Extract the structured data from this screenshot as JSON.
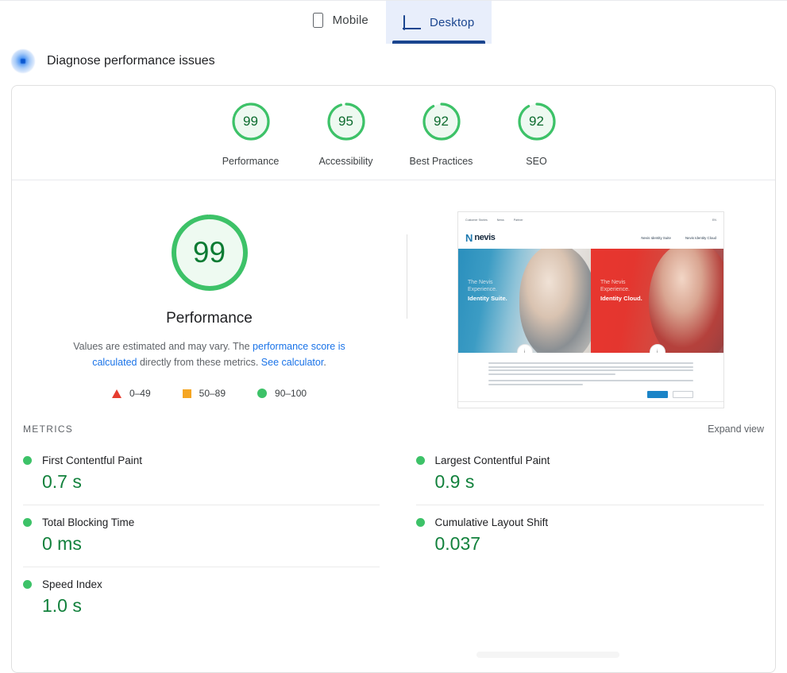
{
  "tabs": [
    {
      "label": "Mobile",
      "icon": "phone-icon",
      "active": false
    },
    {
      "label": "Desktop",
      "icon": "monitor-icon",
      "active": true
    }
  ],
  "diagnose": {
    "title": "Diagnose performance issues",
    "icon": "sparkle-icon"
  },
  "category_scores": [
    {
      "label": "Performance",
      "score": "99"
    },
    {
      "label": "Accessibility",
      "score": "95"
    },
    {
      "label": "Best Practices",
      "score": "92"
    },
    {
      "label": "SEO",
      "score": "92"
    }
  ],
  "hero": {
    "score": "99",
    "category": "Performance",
    "note_part1": "Values are estimated and may vary. The ",
    "note_link1": "performance score is calculated",
    "note_part2": " directly from these metrics. ",
    "note_link2": "See calculator",
    "note_part3": "."
  },
  "legend": [
    {
      "shape": "triangle",
      "range": "0–49",
      "color": "#e63c2f"
    },
    {
      "shape": "square",
      "range": "50–89",
      "color": "#f5a623"
    },
    {
      "shape": "circle",
      "range": "90–100",
      "color": "#3dc268"
    }
  ],
  "screenshot_preview": {
    "topnav": [
      "Customer Stories",
      "News",
      "Partner"
    ],
    "lang": "EN",
    "logo_mark": "N",
    "logo_word": "nevis",
    "header_nav": [
      "Nevis Identity Suite",
      "Nevis Identity Cloud"
    ],
    "panes": [
      {
        "line1": "The Nevis",
        "line2": "Experience.",
        "line3": "Identity Suite.",
        "theme": "blue"
      },
      {
        "line1": "The Nevis",
        "line2": "Experience.",
        "line3": "Identity Cloud.",
        "theme": "red"
      }
    ],
    "badge": "i"
  },
  "metrics_section": {
    "title": "METRICS",
    "expand_label": "Expand view",
    "left": [
      {
        "name": "First Contentful Paint",
        "value": "0.7 s",
        "status": "good"
      },
      {
        "name": "Total Blocking Time",
        "value": "0 ms",
        "status": "good"
      },
      {
        "name": "Speed Index",
        "value": "1.0 s",
        "status": "good"
      }
    ],
    "right": [
      {
        "name": "Largest Contentful Paint",
        "value": "0.9 s",
        "status": "good"
      },
      {
        "name": "Cumulative Layout Shift",
        "value": "0.037",
        "status": "good"
      }
    ]
  },
  "colors": {
    "good": "#3dc268",
    "good_text": "#12813c",
    "average": "#f5a623",
    "poor": "#e63c2f",
    "accent_blue": "#1a73e8",
    "tab_active": "#1a458f",
    "tab_active_bg": "#e8eefb"
  }
}
